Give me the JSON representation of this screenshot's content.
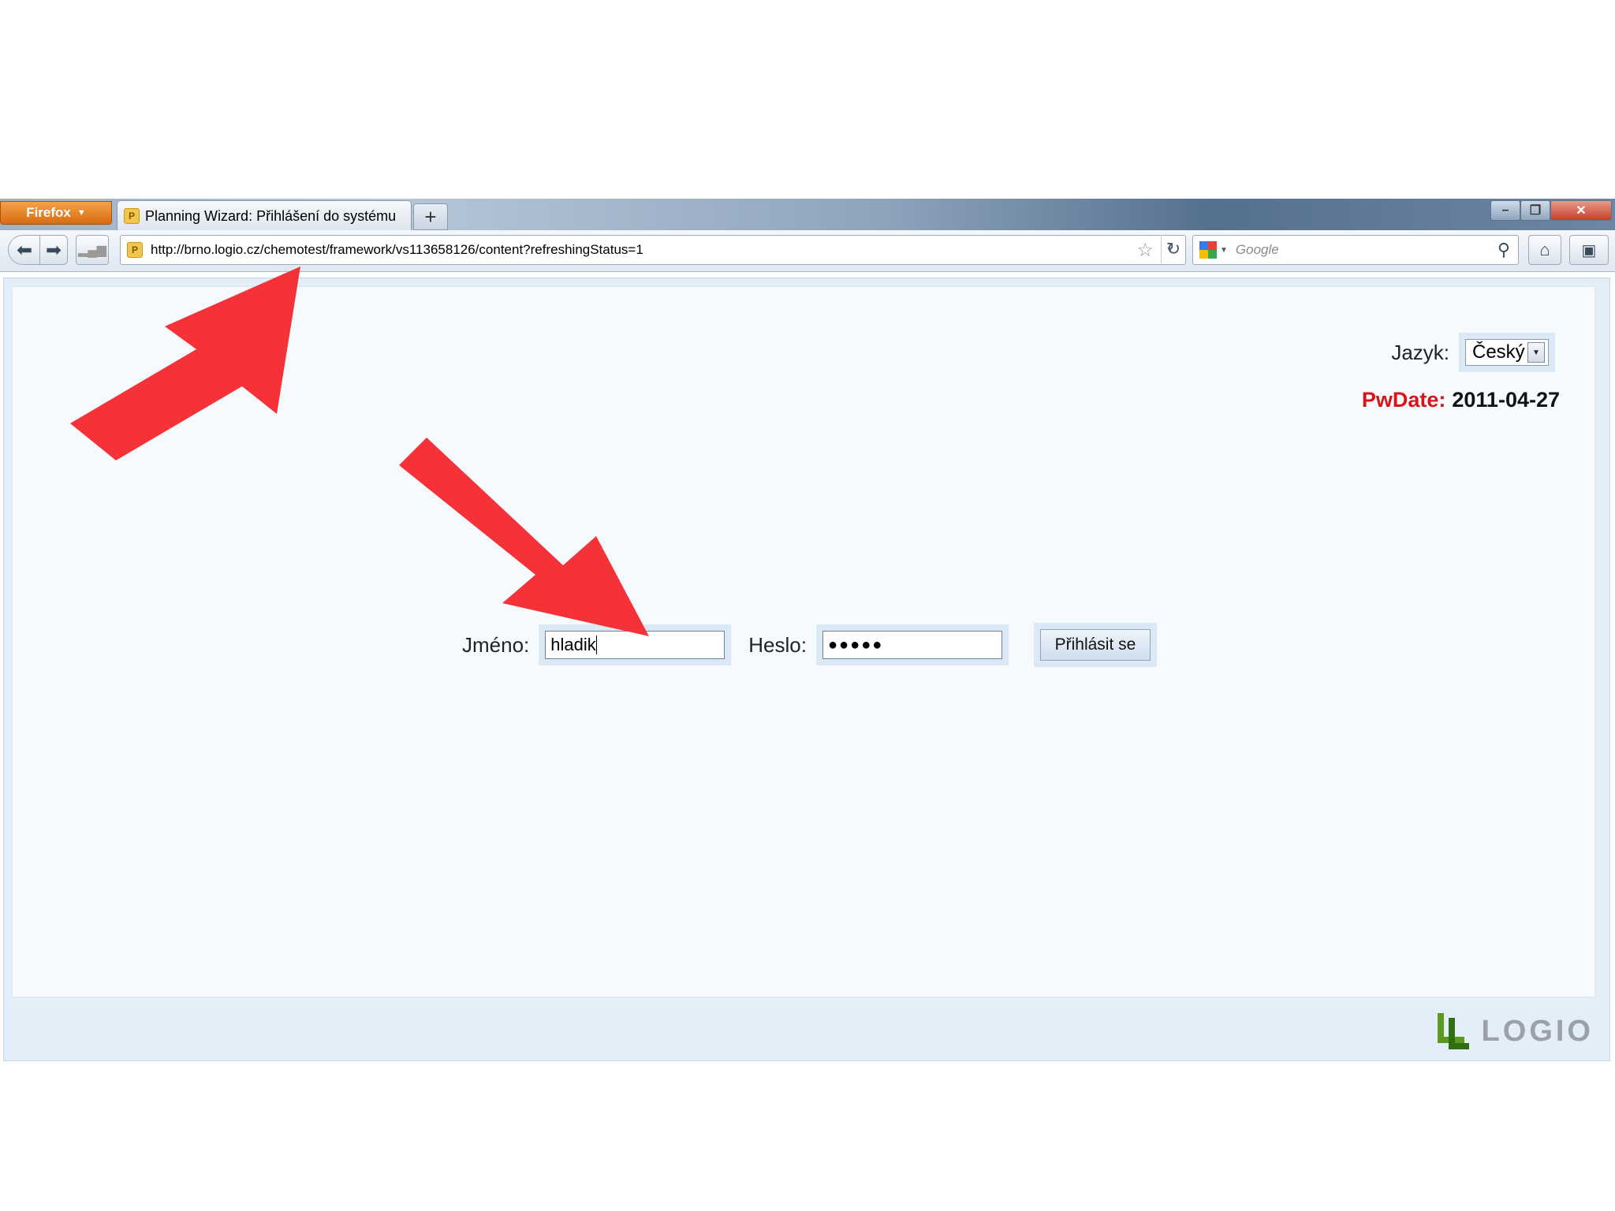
{
  "browser": {
    "app_button": "Firefox",
    "tab_title": "Planning Wizard: Přihlášení do systému",
    "new_tab": "+",
    "url": "http://brno.logio.cz/chemotest/framework/vs113658126/content?refreshingStatus=1",
    "search_placeholder": "Google"
  },
  "page": {
    "language_label": "Jazyk:",
    "language_value": "Český",
    "pwdate_label": "PwDate:",
    "pwdate_value": "2011-04-27",
    "username_label": "Jméno:",
    "username_value": "hladik",
    "password_label": "Heslo:",
    "password_value": "●●●●●",
    "login_button": "Přihlásit se",
    "logo_text": "LOGIO"
  },
  "colors": {
    "annotation_arrow": "#f43238",
    "pwdate_label": "#d5151b",
    "logo_green": "#5a9a1e"
  }
}
